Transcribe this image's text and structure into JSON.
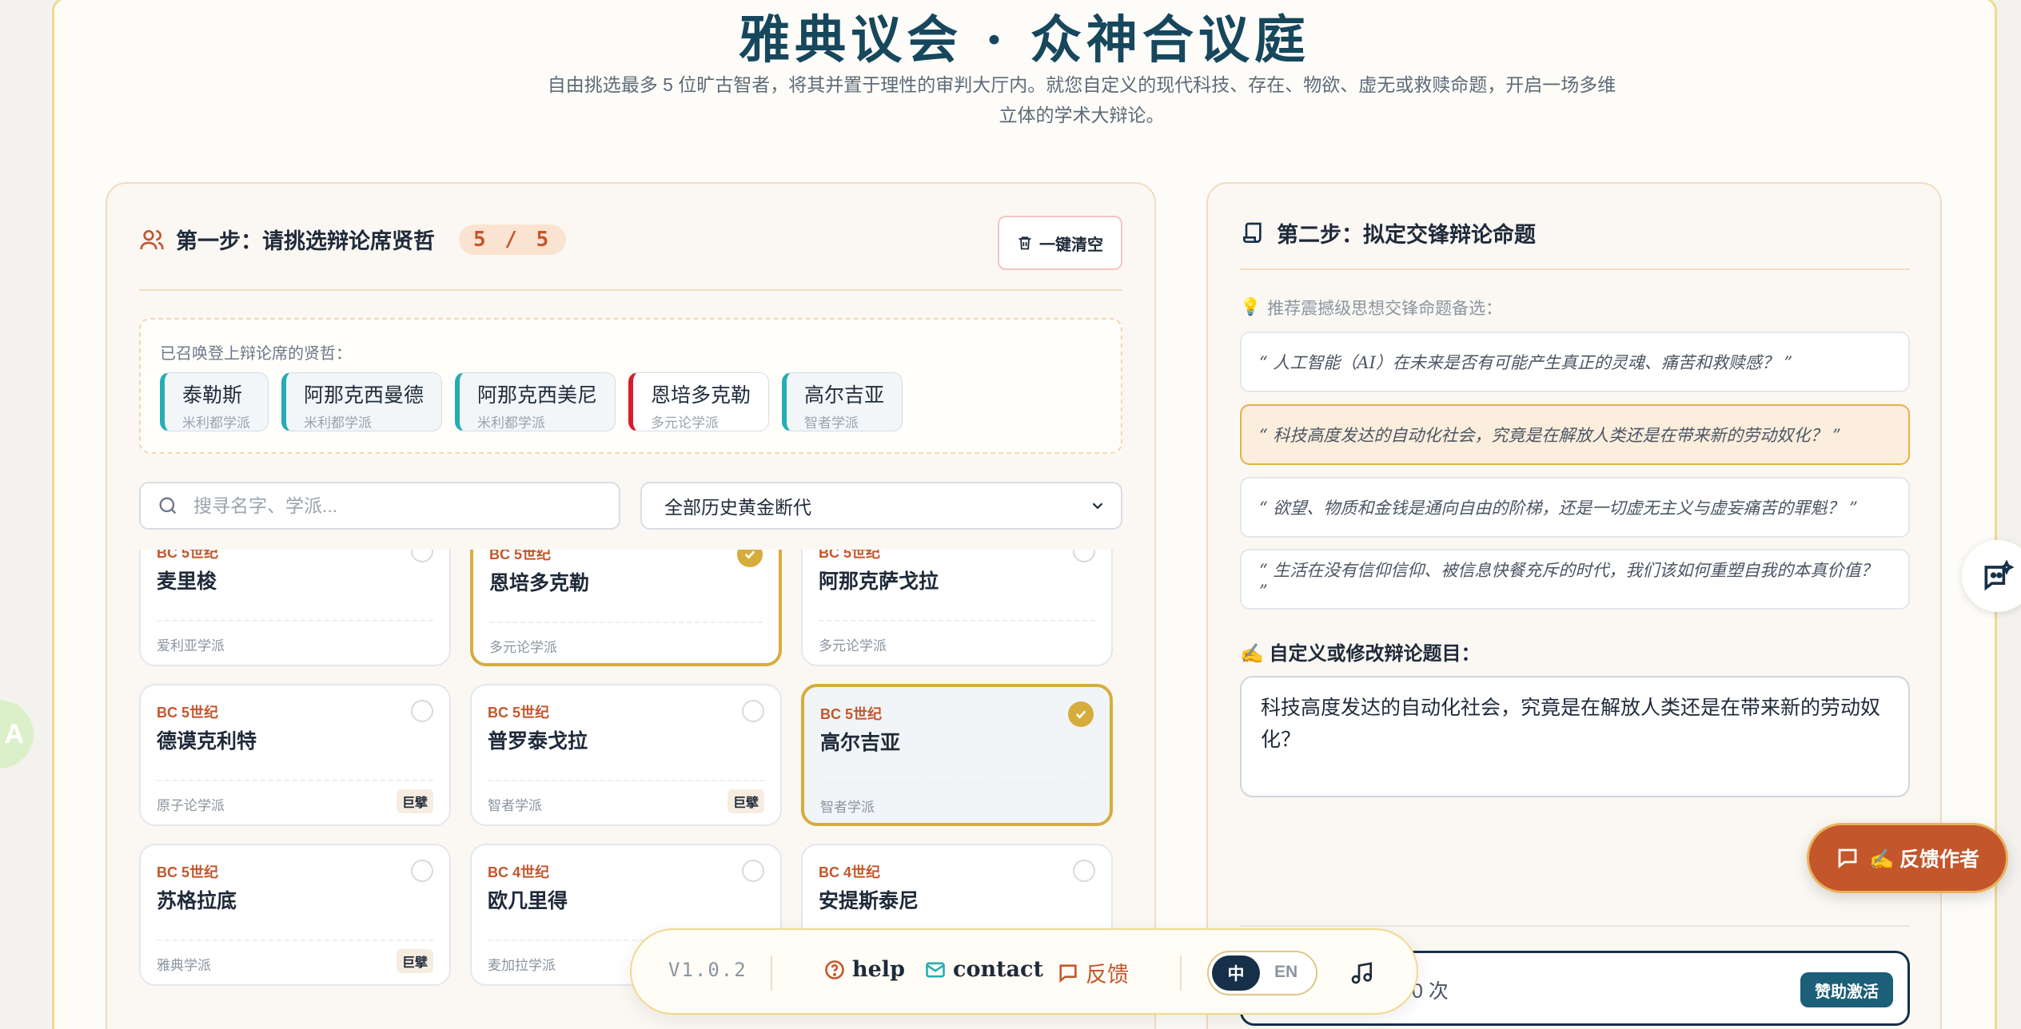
{
  "header": {
    "title": "雅典议会 · 众神合议庭",
    "subtitle": "自由挑选最多 5 位旷古智者，将其并置于理性的审判大厅内。就您自定义的现代科技、存在、物欲、虚无或救赎命题，开启一场多维立体的学术大辩论。"
  },
  "step1": {
    "title": "第一步：请挑选辩论席贤哲",
    "count": "5 / 5",
    "clear_label": "一键清空",
    "selected_label": "已召唤登上辩论席的贤哲：",
    "selected": [
      {
        "name": "泰勒斯",
        "school": "米利都学派"
      },
      {
        "name": "阿那克西曼德",
        "school": "米利都学派"
      },
      {
        "name": "阿那克西美尼",
        "school": "米利都学派"
      },
      {
        "name": "恩培多克勒",
        "school": "多元论学派"
      },
      {
        "name": "高尔吉亚",
        "school": "智者学派"
      }
    ],
    "search_placeholder": "搜寻名字、学派...",
    "era_select": "全部历史黄金断代",
    "cards": [
      {
        "era": "BC 5世纪",
        "name": "麦里梭",
        "school": "爱利亚学派",
        "badge": "",
        "state": "none"
      },
      {
        "era": "BC 5世纪",
        "name": "恩培多克勒",
        "school": "多元论学派",
        "badge": "",
        "state": "gold"
      },
      {
        "era": "BC 5世纪",
        "name": "阿那克萨戈拉",
        "school": "多元论学派",
        "badge": "",
        "state": "none"
      },
      {
        "era": "BC 5世纪",
        "name": "德谟克利特",
        "school": "原子论学派",
        "badge": "巨擘",
        "state": "none"
      },
      {
        "era": "BC 5世纪",
        "name": "普罗泰戈拉",
        "school": "智者学派",
        "badge": "巨擘",
        "state": "none"
      },
      {
        "era": "BC 5世纪",
        "name": "高尔吉亚",
        "school": "智者学派",
        "badge": "",
        "state": "blue"
      },
      {
        "era": "BC 5世纪",
        "name": "苏格拉底",
        "school": "雅典学派",
        "badge": "巨擘",
        "state": "none"
      },
      {
        "era": "BC 4世纪",
        "name": "欧几里得",
        "school": "麦加拉学派",
        "badge": "",
        "state": "none"
      },
      {
        "era": "BC 4世纪",
        "name": "安提斯泰尼",
        "school": "",
        "badge": "",
        "state": "none"
      }
    ]
  },
  "step2": {
    "title": "第二步：拟定交锋辩论命题",
    "hint": "推荐震撼级思想交锋命题备选：",
    "topics": [
      "“ 人工智能（AI）在未来是否有可能产生真正的灵魂、痛苦和救赎感？ ”",
      "“ 科技高度发达的自动化社会，究竟是在解放人类还是在带来新的劳动奴化？ ”",
      "“ 欲望、物质和金钱是通向自由的阶梯，还是一切虚无主义与虚妄痛苦的罪魁？ ”",
      "“ 生活在没有信仰信仰、被信息快餐充斥的时代，我们该如何重塑自我的本真价值？ ”"
    ],
    "custom_label": "✍️ 自定义或修改辩论题目：",
    "custom_value": "科技高度发达的自动化社会，究竟是在解放人类还是在带来新的劳动奴化？",
    "sponsor_count": "0 次",
    "sponsor_button": "赞助激活"
  },
  "floatbar": {
    "version": "V1.0.2",
    "help": "help",
    "contact": "contact",
    "feedback": "反馈",
    "lang_zh": "中",
    "lang_en": "EN"
  },
  "fab": {
    "feedback_author": "✍️ 反馈作者"
  },
  "colors": {
    "accent": "#c4562b",
    "gold": "#d6ad3d",
    "navy": "#17304a",
    "teal": "#25adb4"
  }
}
